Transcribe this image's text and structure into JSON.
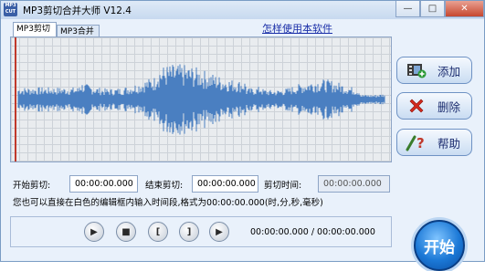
{
  "window": {
    "title": "MP3剪切合并大师 V12.4",
    "icon_label": "MP3 CUT",
    "controls": {
      "minimize": "—",
      "maximize": "□",
      "close": "✕"
    }
  },
  "tabs": [
    {
      "label": "MP3剪切",
      "active": true
    },
    {
      "label": "MP3合并",
      "active": false
    }
  ],
  "help_link": "怎样使用本软件",
  "waveform": {
    "color": "#4a7fc1",
    "grid_color": "#cdd2d8",
    "cursor_color": "#c0392b"
  },
  "side_buttons": [
    {
      "label": "添加",
      "icon": "film-add-icon"
    },
    {
      "label": "删除",
      "icon": "red-x-icon"
    },
    {
      "label": "帮助",
      "icon": "help-icon"
    }
  ],
  "cut": {
    "start_label": "开始剪切:",
    "start_value": "00:00:00.000",
    "end_label": "结束剪切:",
    "end_value": "00:00:00.000",
    "duration_label": "剪切时间:",
    "duration_value": "00:00:00.000"
  },
  "hint": "您也可以直接在白色的编辑框内输入时间段,格式为00:00:00.000(时,分,秒,毫秒)",
  "player": {
    "buttons": [
      {
        "name": "play",
        "glyph": "▶"
      },
      {
        "name": "stop",
        "glyph": "■"
      },
      {
        "name": "mark-start",
        "glyph": "["
      },
      {
        "name": "mark-end",
        "glyph": "]"
      },
      {
        "name": "play-selection",
        "glyph": "▶"
      }
    ],
    "time_display": "00:00:00.000 / 00:00:00.000"
  },
  "start_button": "开始"
}
